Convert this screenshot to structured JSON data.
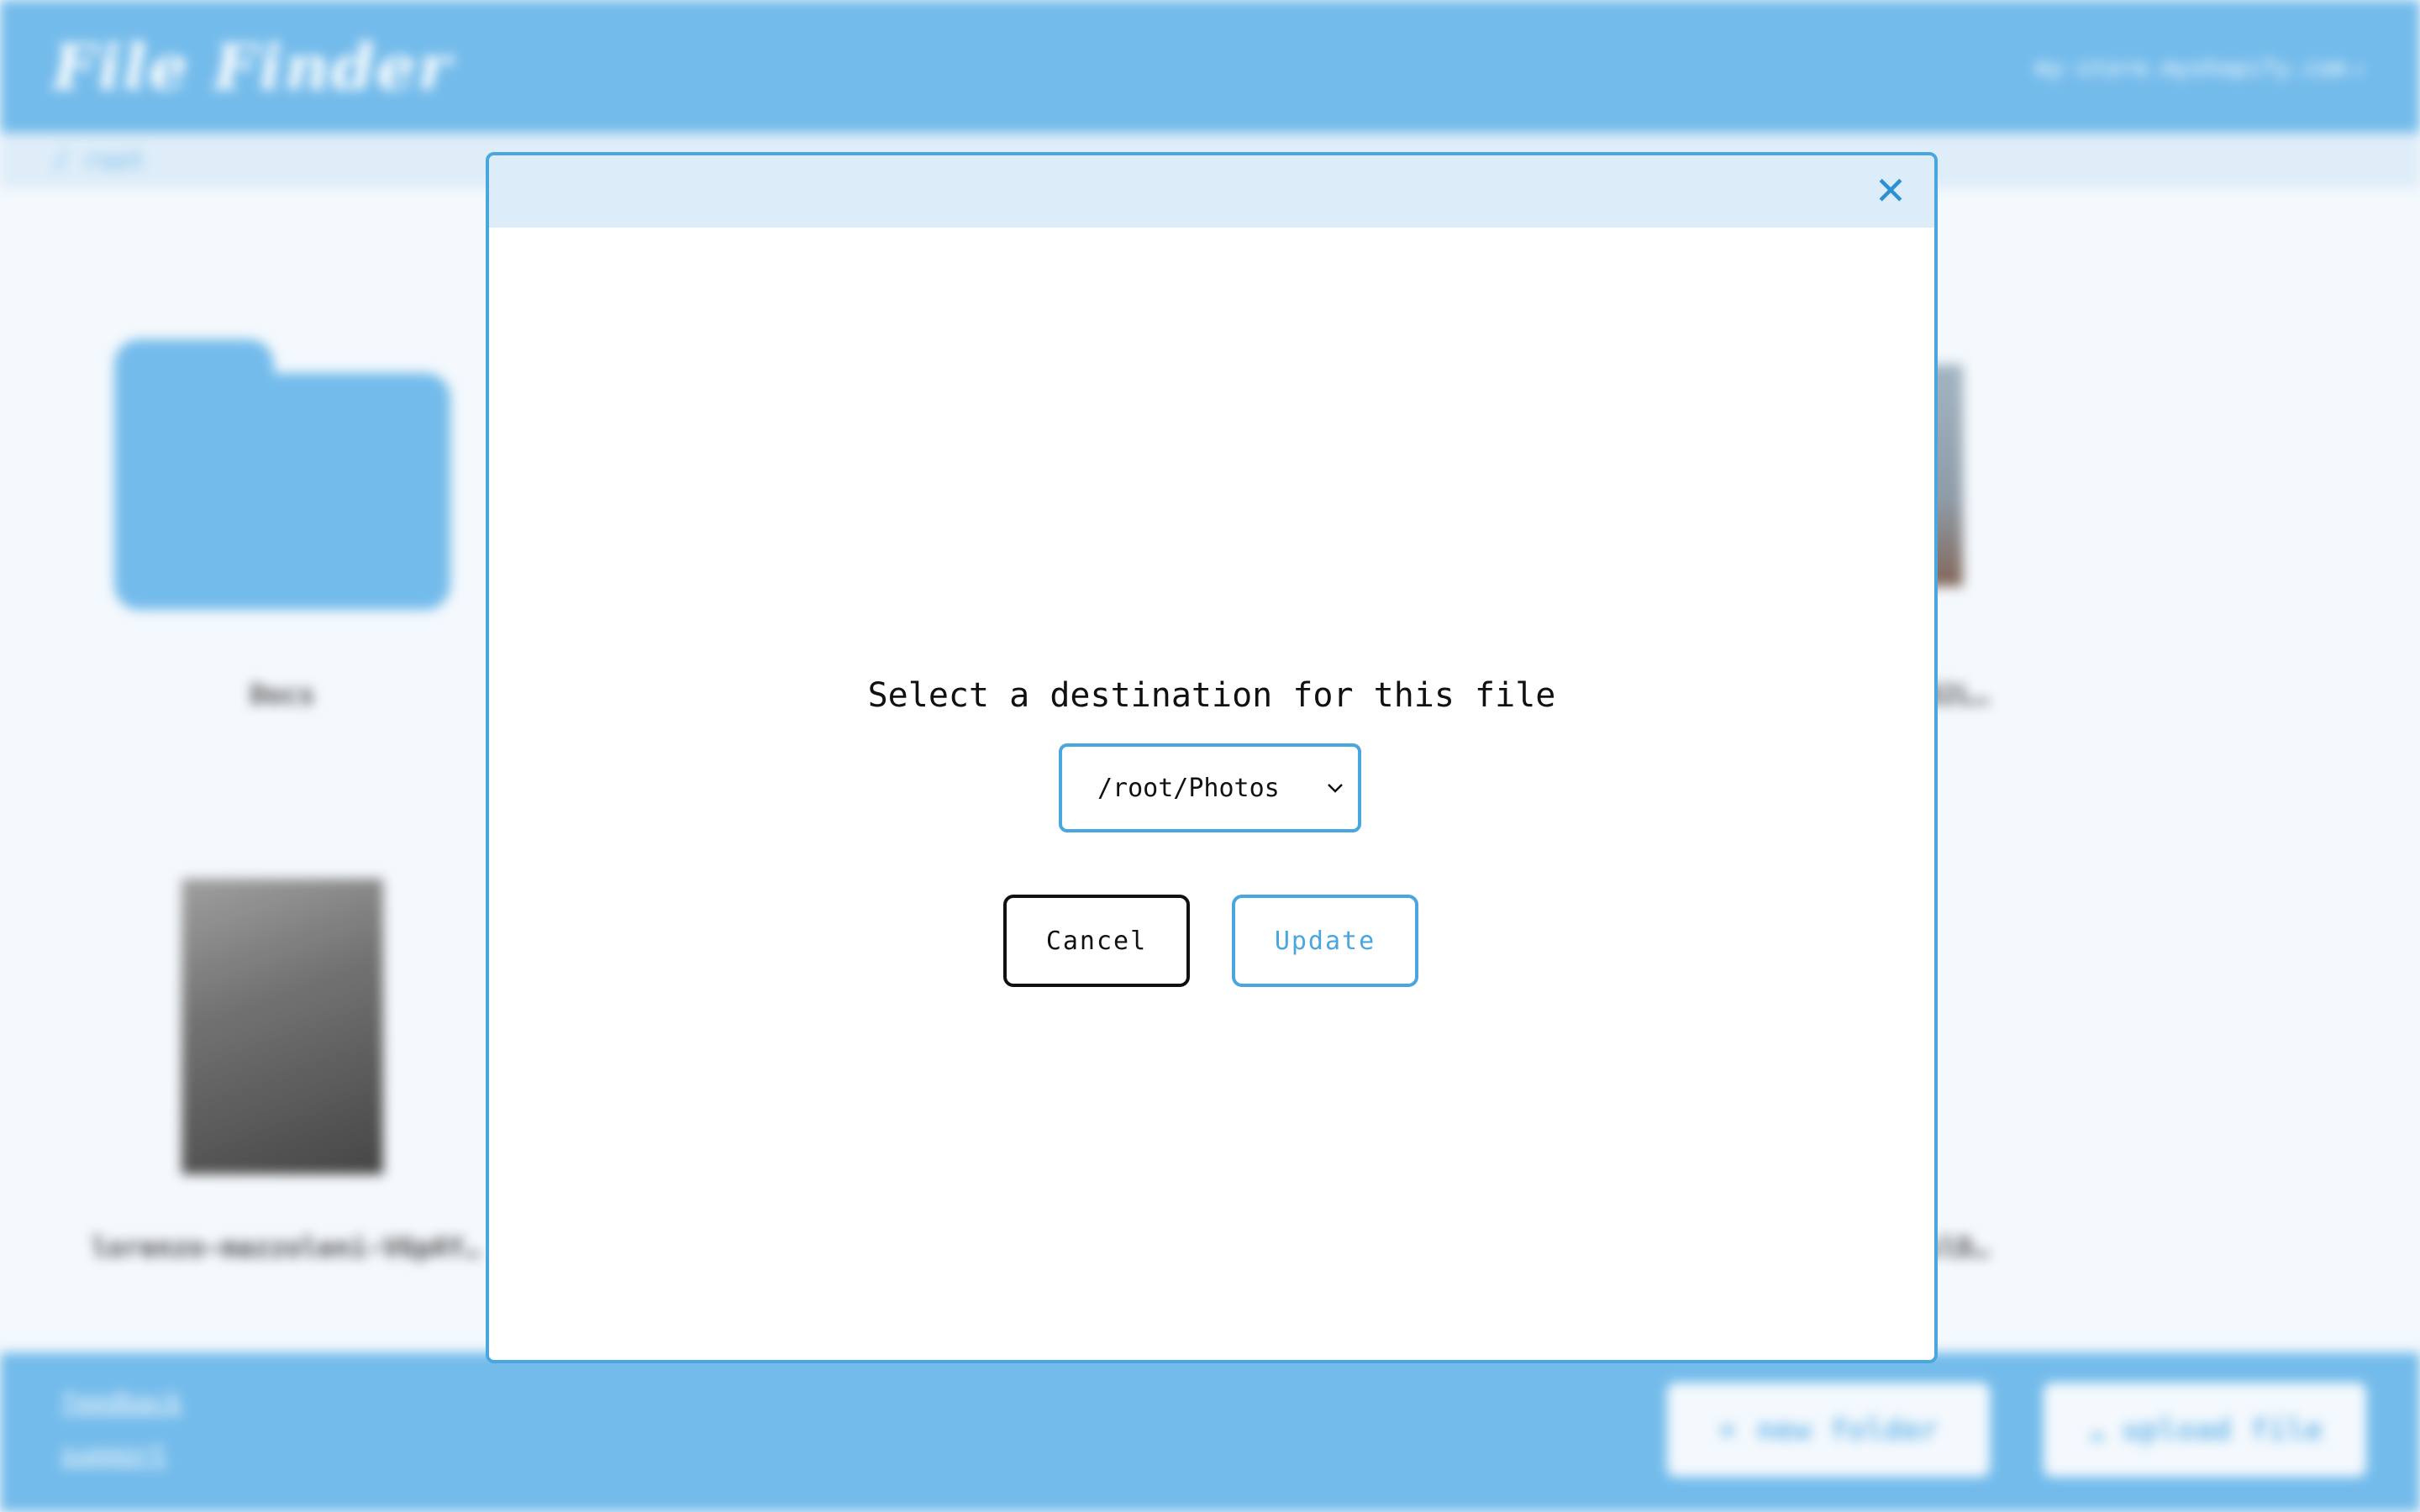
{
  "app": {
    "title": "File Finder",
    "store_link": "my-store.myshopify.com"
  },
  "breadcrumb": "/ root",
  "grid": {
    "items": [
      {
        "label": "Docs",
        "type": "folder"
      },
      {
        "label": "lorenzo-mazzoleni-V6pAY…",
        "type": "image"
      },
      {
        "label": "02L…",
        "type": "image"
      },
      {
        "label": "slD…",
        "type": "image"
      }
    ]
  },
  "footer": {
    "links": [
      "feedback",
      "support"
    ],
    "new_folder_label": "new folder",
    "upload_file_label": "upload file"
  },
  "modal": {
    "title": "Select a destination for this file",
    "destination_value": "/root/Photos",
    "cancel_label": "Cancel",
    "update_label": "Update",
    "close_glyph": "✕"
  },
  "colors": {
    "primary": "#6bb7ea",
    "accent": "#4aa6df",
    "modal_header": "#dcecf8"
  }
}
